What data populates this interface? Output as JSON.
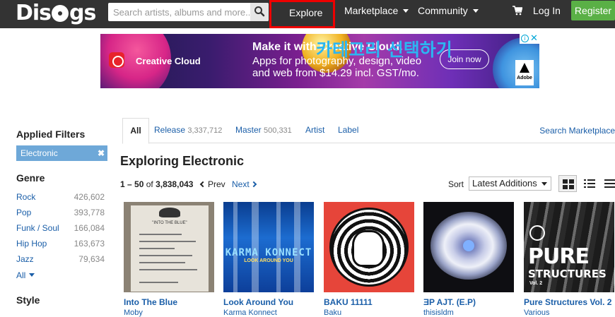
{
  "header": {
    "logo": "Discogs",
    "search_placeholder": "Search artists, albums and more...",
    "nav": {
      "explore": "Explore",
      "marketplace": "Marketplace",
      "community": "Community",
      "login": "Log In",
      "register": "Register"
    }
  },
  "ad": {
    "brand": "Creative Cloud",
    "headline": "Make it with Creative Cloud.",
    "sub": "Apps for photography, design, video and web from $14.29 incl. GST/mo.",
    "cta": "Join now",
    "adobe": "Adobe",
    "overlay": "카테고리 선택하기",
    "info": "i",
    "close": "✕"
  },
  "sidebar": {
    "applied_filters": "Applied Filters",
    "chip": "Electronic",
    "chip_remove": "✖",
    "genre_heading": "Genre",
    "genres": [
      {
        "name": "Rock",
        "count": "426,602"
      },
      {
        "name": "Pop",
        "count": "393,778"
      },
      {
        "name": "Funk / Soul",
        "count": "166,084"
      },
      {
        "name": "Hip Hop",
        "count": "163,673"
      },
      {
        "name": "Jazz",
        "count": "79,634"
      }
    ],
    "all": "All",
    "style_heading": "Style"
  },
  "tabs": {
    "all": "All",
    "release": "Release",
    "release_count": "3,337,712",
    "master": "Master",
    "master_count": "500,331",
    "artist": "Artist",
    "label": "Label",
    "search_marketplace": "Search Marketplace"
  },
  "main": {
    "title": "Exploring Electronic",
    "range": "1 – 50",
    "of_text": "of",
    "total": "3,838,043",
    "prev": "Prev",
    "next": "Next",
    "sort_label": "Sort",
    "sort_value": "Latest Additions"
  },
  "releases": [
    {
      "title": "Into The Blue",
      "artist": "Moby",
      "cover_text": "\"INTO THE BLUE\""
    },
    {
      "title": "Look Around You",
      "artist": "Karma Konnect",
      "cover_text": "KARMA KONNECT",
      "cover_sub": "LOOK AROUND YOU"
    },
    {
      "title": "BAKU 11111",
      "artist": "Baku"
    },
    {
      "title": "ƎP AJT. (E.P)",
      "artist": "thisisldm"
    },
    {
      "title": "Pure Structures Vol. 2",
      "artist": "Various",
      "cover_text": "PURE",
      "cover_sub": "STRUCTURES",
      "cover_vol": "Vol. 2"
    }
  ],
  "colors": {
    "topbar": "#333333",
    "register": "#5ab046",
    "link": "#1a5ea8",
    "chip": "#6ea8d8",
    "highlight": "#ee0000"
  }
}
